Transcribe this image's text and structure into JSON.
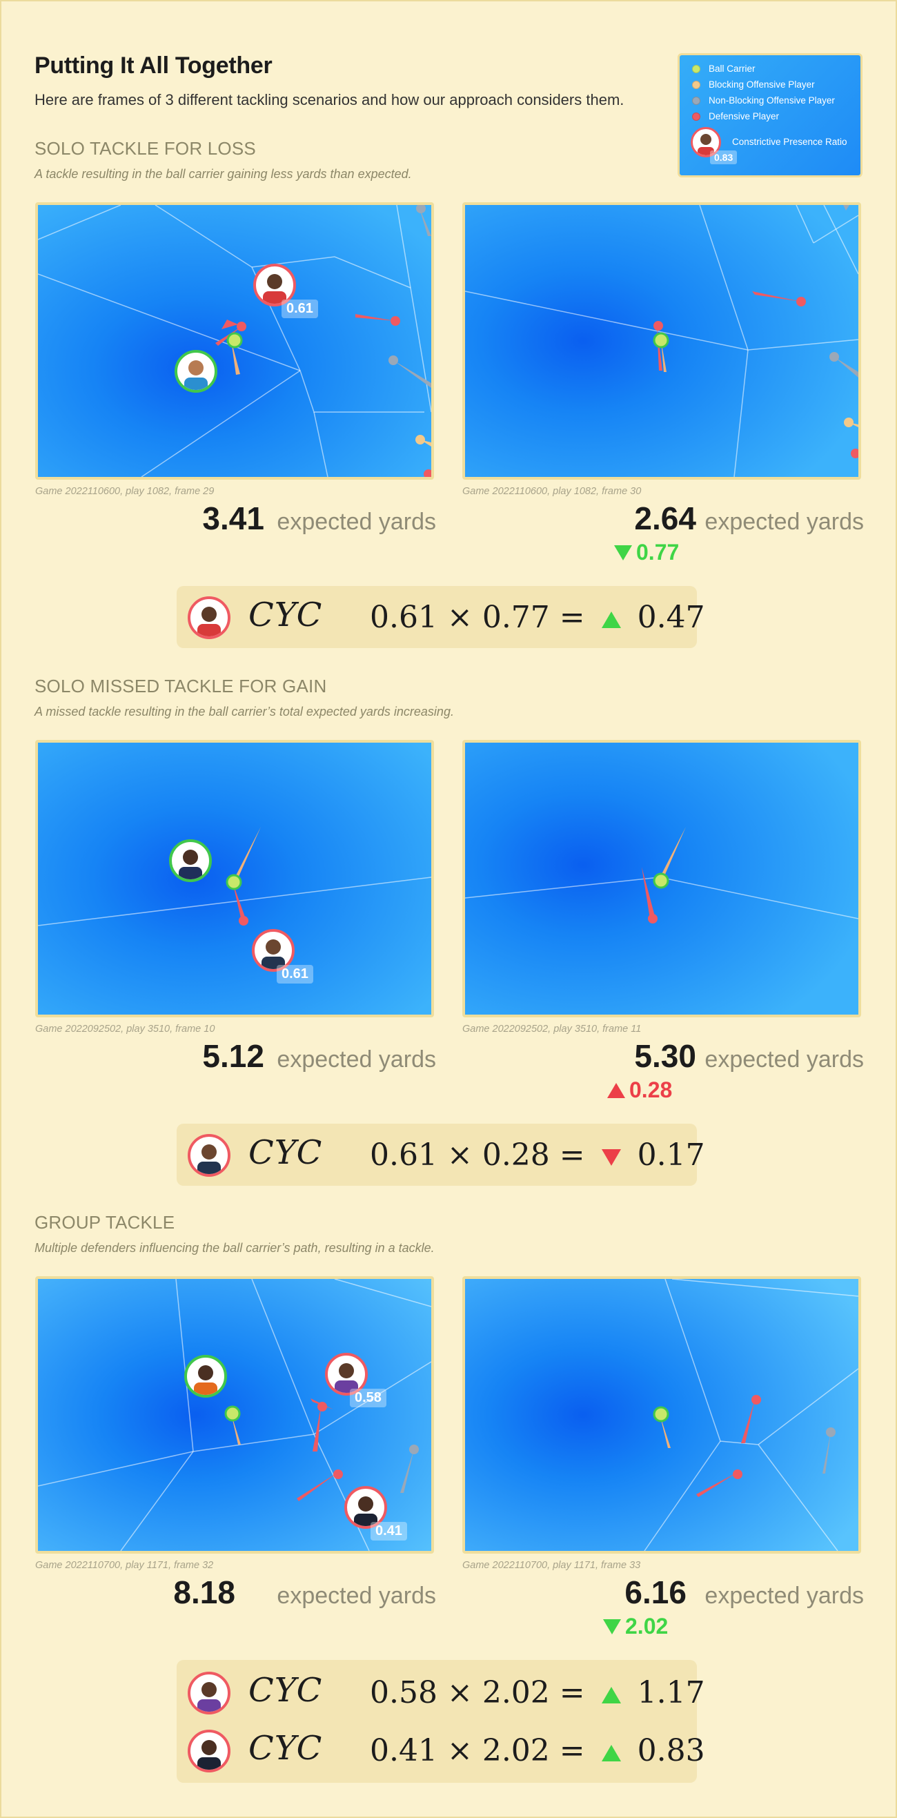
{
  "header": {
    "title": "Putting It All Together",
    "subtitle": "Here are frames of 3 different tackling scenarios and how our approach considers them."
  },
  "legend": {
    "items": [
      {
        "label": "Ball Carrier",
        "color": "#c8e86a"
      },
      {
        "label": "Blocking Offensive Player",
        "color": "#f3c98a"
      },
      {
        "label": "Non-Blocking Offensive Player",
        "color": "#9aa8b8"
      },
      {
        "label": "Defensive Player",
        "color": "#ef5a62"
      }
    ],
    "ratio_label": "Constrictive Presence Ratio",
    "ratio_value": "0.83"
  },
  "units_label": "expected yards",
  "cyc_symbol": "CYC",
  "colors": {
    "good": "#3fd546",
    "bad": "#ec3f48",
    "defender": "#ef5a62",
    "carrier_ring": "#41c74b"
  },
  "sections": [
    {
      "title": "SOLO TACKLE FOR LOSS",
      "desc": "A tackle resulting in the ball carrier gaining less yards than expected.",
      "left": {
        "caption": "Game 2022110600, play 1082, frame 29",
        "yards": "3.41",
        "badges": [
          "0.61"
        ]
      },
      "right": {
        "caption": "Game 2022110600, play 1082, frame 30",
        "yards": "2.64",
        "delta": "0.77",
        "delta_dir": "down"
      },
      "formulas": [
        {
          "a": "0.61",
          "b": "0.77",
          "result": "0.47",
          "dir": "up"
        }
      ]
    },
    {
      "title": "SOLO MISSED TACKLE FOR GAIN",
      "desc": "A missed tackle resulting in the ball carrier’s total expected yards increasing.",
      "left": {
        "caption": "Game 2022092502, play 3510, frame 10",
        "yards": "5.12",
        "badges": [
          "0.61"
        ]
      },
      "right": {
        "caption": "Game 2022092502, play 3510, frame 11",
        "yards": "5.30",
        "delta": "0.28",
        "delta_dir": "up"
      },
      "formulas": [
        {
          "a": "0.61",
          "b": "0.28",
          "result": "0.17",
          "dir": "down"
        }
      ]
    },
    {
      "title": "GROUP TACKLE",
      "desc": "Multiple defenders influencing the ball carrier’s path, resulting in a tackle.",
      "left": {
        "caption": "Game 2022110700, play 1171, frame 32",
        "yards": "8.18",
        "badges": [
          "0.58",
          "0.41"
        ]
      },
      "right": {
        "caption": "Game 2022110700, play 1171, frame 33",
        "yards": "6.16",
        "delta": "2.02",
        "delta_dir": "down"
      },
      "formulas": [
        {
          "a": "0.58",
          "b": "2.02",
          "result": "1.17",
          "dir": "up"
        },
        {
          "a": "0.41",
          "b": "2.02",
          "result": "0.83",
          "dir": "up"
        }
      ]
    }
  ]
}
